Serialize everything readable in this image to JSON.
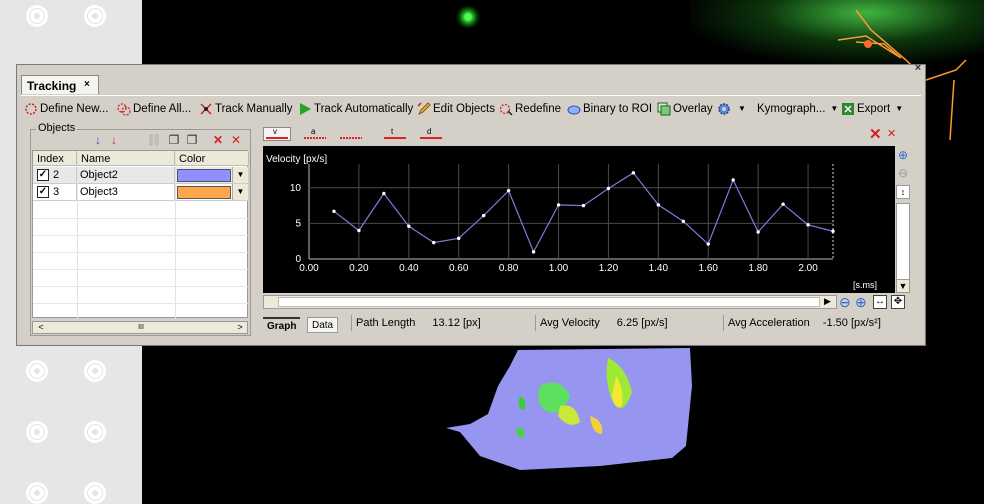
{
  "window": {
    "tab_title": "Tracking",
    "tab_close": "×",
    "close_glyph": "×"
  },
  "toolbar": {
    "define_new": "Define New...",
    "define_all": "Define All...",
    "track_manually": "Track Manually",
    "track_automatically": "Track Automatically",
    "edit_objects": "Edit Objects",
    "redefine": "Redefine",
    "binary_to_roi": "Binary to ROI",
    "overlay": "Overlay",
    "kymograph": "Kymograph...",
    "export": "Export"
  },
  "objects": {
    "legend": "Objects",
    "columns": [
      "Index",
      "Name",
      "Color"
    ],
    "rows": [
      {
        "checked": true,
        "index": "2",
        "name": "Object2",
        "color": "#8f8fff"
      },
      {
        "checked": true,
        "index": "3",
        "name": "Object3",
        "color": "#ffa54a"
      }
    ],
    "scroll_left": "<",
    "scroll_right": ">",
    "scroll_grip": "III"
  },
  "graph_tools": {
    "velocity": "v",
    "acceleration": "a",
    "dotted": "",
    "time": "t",
    "distance": "d"
  },
  "chart_data": {
    "type": "line",
    "ylabel": "Velocity [px/s]",
    "xlabel": "[s.ms]",
    "x_ticks": [
      "0.00",
      "0.20",
      "0.40",
      "0.60",
      "0.80",
      "1.00",
      "1.20",
      "1.40",
      "1.60",
      "1.80",
      "2.00"
    ],
    "y_ticks": [
      "0",
      "5",
      "10"
    ],
    "xlim": [
      0,
      2.1
    ],
    "ylim": [
      0,
      12.5
    ],
    "grid": true,
    "x": [
      0.1,
      0.2,
      0.3,
      0.4,
      0.5,
      0.6,
      0.7,
      0.8,
      0.9,
      1.0,
      1.1,
      1.2,
      1.3,
      1.4,
      1.5,
      1.6,
      1.7,
      1.8,
      1.9,
      2.0,
      2.1
    ],
    "values": [
      6.7,
      4.0,
      9.2,
      4.6,
      2.3,
      2.9,
      6.1,
      9.6,
      1.0,
      7.6,
      7.5,
      9.9,
      12.1,
      7.6,
      5.3,
      2.1,
      11.1,
      3.8,
      7.7,
      4.8,
      3.9
    ],
    "line_color": "#7b7bdc",
    "point_color": "#ffffff"
  },
  "status": {
    "graph_tab": "Graph",
    "data_tab": "Data",
    "path_length_label": "Path Length",
    "path_length_value": "13.12 [px]",
    "avg_velocity_label": "Avg Velocity",
    "avg_velocity_value": "6.25 [px/s]",
    "avg_accel_label": "Avg Acceleration",
    "avg_accel_value": "-1.50 [px/s²]"
  },
  "colors": {
    "window_bg": "#d4d0c8",
    "chart_bg": "#000000",
    "grid": "#555555",
    "blob": "#9696f0"
  }
}
